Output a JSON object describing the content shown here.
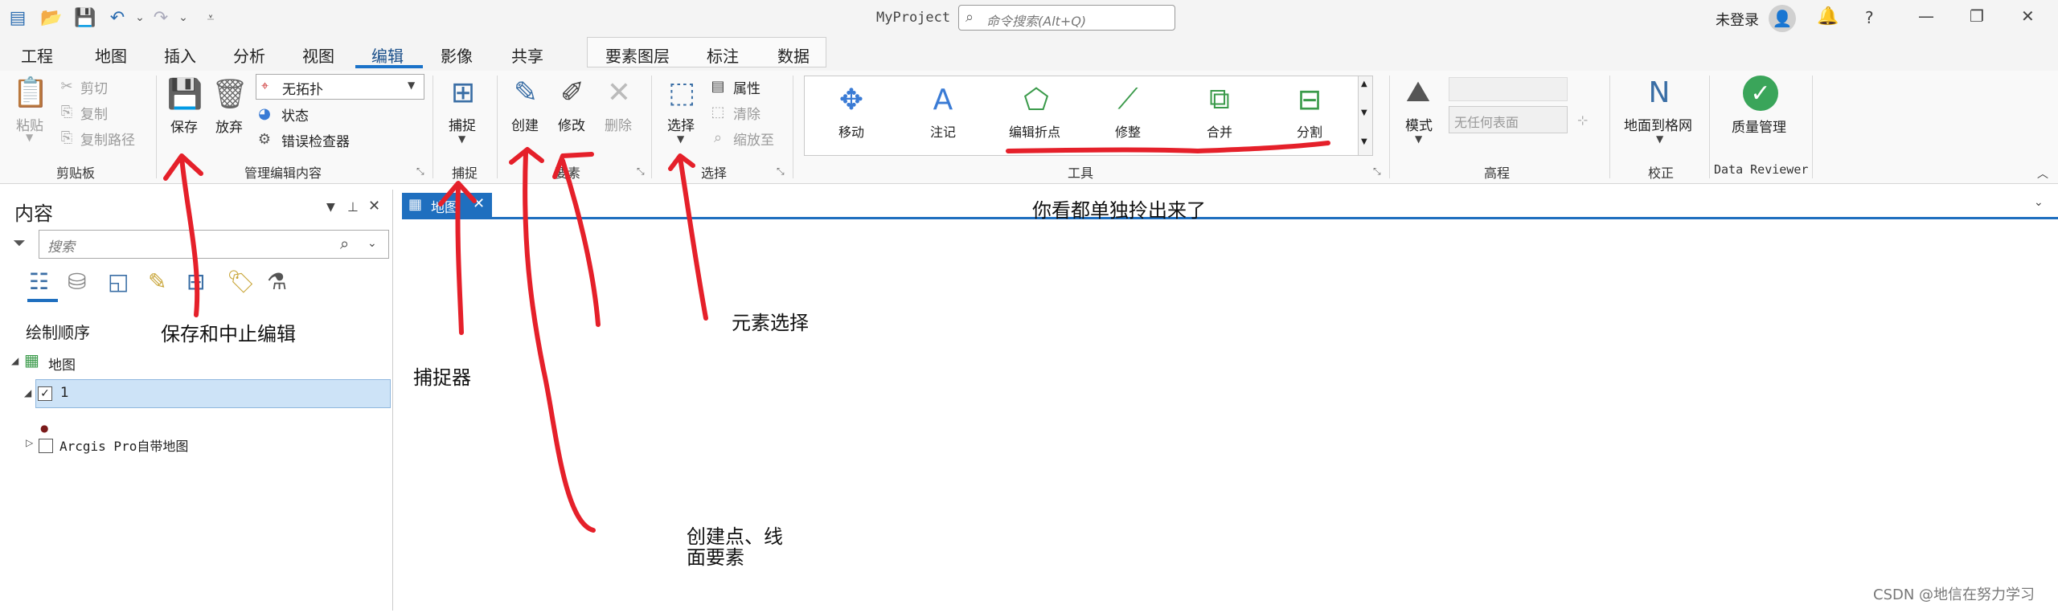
{
  "titlebar": {
    "app_title": "MyProject",
    "search_placeholder": "命令搜索(Alt+Q)",
    "login": "未登录",
    "help": "?"
  },
  "tabs": [
    "工程",
    "地图",
    "插入",
    "分析",
    "视图",
    "编辑",
    "影像",
    "共享"
  ],
  "active_tab": "编辑",
  "contextual_tabs": [
    "要素图层",
    "标注",
    "数据"
  ],
  "ribbon": {
    "clipboard": {
      "paste": "粘贴",
      "cut": "剪切",
      "copy": "复制",
      "copy_path": "复制路径",
      "group": "剪贴板"
    },
    "manage": {
      "save": "保存",
      "discard": "放弃",
      "topology": "无拓扑",
      "status": "状态",
      "error_inspector": "错误检查器",
      "group": "管理编辑内容"
    },
    "snapping": {
      "snap": "捕捉",
      "group": "捕捉"
    },
    "features": {
      "create": "创建",
      "modify": "修改",
      "delete": "删除",
      "group": "要素"
    },
    "selection": {
      "select": "选择",
      "attributes": "属性",
      "clear": "清除",
      "zoom_to": "缩放至",
      "group": "选择"
    },
    "tools": {
      "items": [
        "移动",
        "注记",
        "编辑折点",
        "修整",
        "合并",
        "分割"
      ],
      "group": "工具"
    },
    "elevation": {
      "mode": "模式",
      "placeholder": "无任何表面",
      "group": "高程"
    },
    "correction": {
      "ground_to_grid": "地面到格网",
      "group": "校正"
    },
    "data_reviewer": {
      "quality": "质量管理",
      "group": "Data Reviewer"
    }
  },
  "contents": {
    "title": "内容",
    "search_placeholder": "搜索",
    "drawing_order": "绘制顺序",
    "map_node": "地图",
    "layer1": "1",
    "basemap": "Arcgis Pro自带地图"
  },
  "map_tab": "地图",
  "annotations": {
    "top_note": "你看都单独拎出来了",
    "save_note": "保存和中止编辑",
    "snap_note": "捕捉器",
    "create_note_line1": "创建点、线",
    "create_note_line2": "面要素",
    "select_note": "元素选择"
  },
  "watermark": "CSDN @地信在努力学习",
  "colors": {
    "accent": "#1f6fbf",
    "annotation_red": "#e5202a",
    "selected_row": "#cde3f7"
  }
}
